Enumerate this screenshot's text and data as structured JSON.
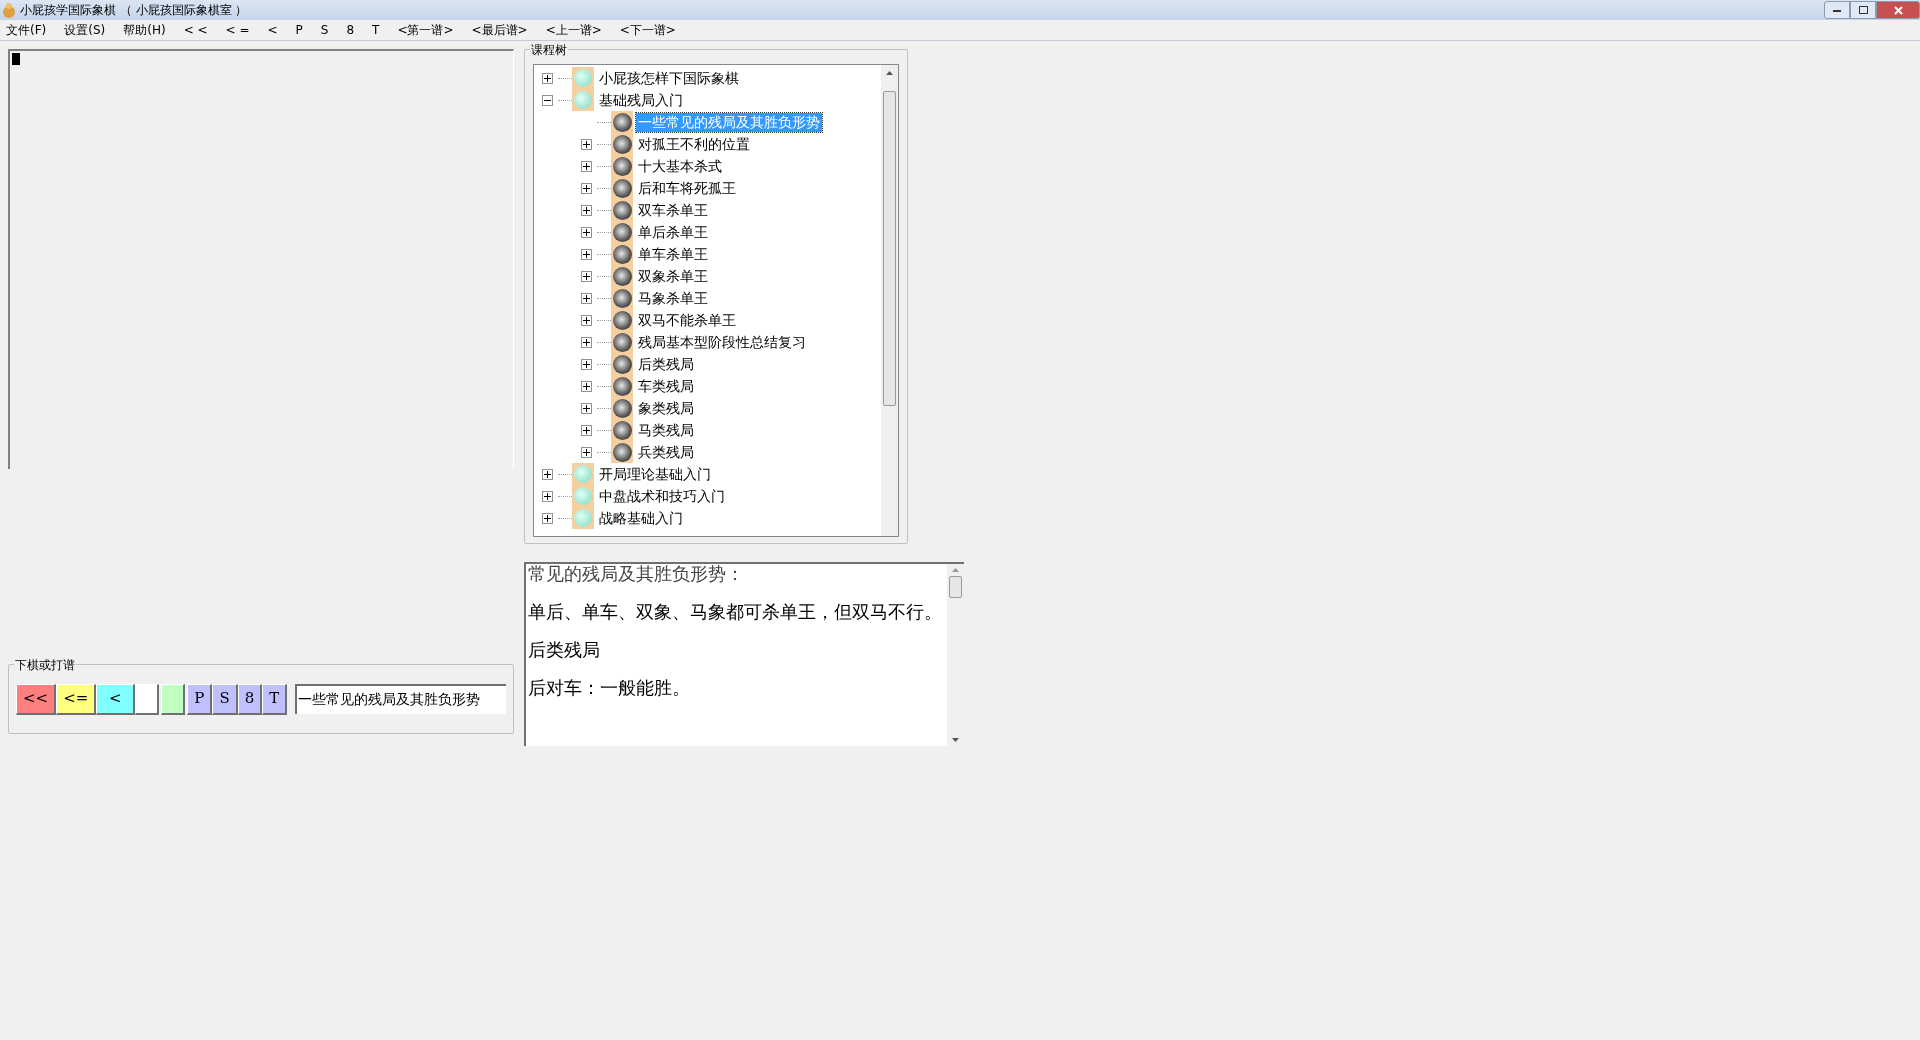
{
  "window": {
    "title": "小屁孩学国际象棋 （ 小屁孩国际象棋室 ）"
  },
  "menu": [
    "文件(F)",
    "设置(S)",
    "帮助(H)",
    "< <",
    "< =",
    "<",
    "P",
    "S",
    "8",
    "T",
    "<第一谱>",
    "<最后谱>",
    "<上一谱>",
    "<下一谱>"
  ],
  "course_tree": {
    "title": "课程树",
    "items": [
      {
        "label": "小屁孩怎样下国际象棋",
        "expanded": false,
        "selected": false
      },
      {
        "label": "基础残局入门",
        "expanded": true,
        "selected": false,
        "children": [
          {
            "label": "一些常见的残局及其胜负形势",
            "selected": true
          },
          {
            "label": "对孤王不利的位置",
            "expanded": false,
            "selected": false
          },
          {
            "label": "十大基本杀式",
            "expanded": false,
            "selected": false
          },
          {
            "label": "后和车将死孤王",
            "expanded": false,
            "selected": false
          },
          {
            "label": "双车杀单王",
            "expanded": false,
            "selected": false
          },
          {
            "label": "单后杀单王",
            "expanded": false,
            "selected": false
          },
          {
            "label": "单车杀单王",
            "expanded": false,
            "selected": false
          },
          {
            "label": "双象杀单王",
            "expanded": false,
            "selected": false
          },
          {
            "label": "马象杀单王",
            "expanded": false,
            "selected": false
          },
          {
            "label": "双马不能杀单王",
            "expanded": false,
            "selected": false
          },
          {
            "label": "残局基本型阶段性总结复习",
            "expanded": false,
            "selected": false
          },
          {
            "label": "后类残局",
            "expanded": false,
            "selected": false
          },
          {
            "label": "车类残局",
            "expanded": false,
            "selected": false
          },
          {
            "label": "象类残局",
            "expanded": false,
            "selected": false
          },
          {
            "label": "马类残局",
            "expanded": false,
            "selected": false
          },
          {
            "label": "兵类残局",
            "expanded": false,
            "selected": false
          }
        ]
      },
      {
        "label": "开局理论基础入门",
        "expanded": false,
        "selected": false
      },
      {
        "label": "中盘战术和技巧入门",
        "expanded": false,
        "selected": false
      },
      {
        "label": "战略基础入门",
        "expanded": false,
        "selected": false
      }
    ]
  },
  "lesson_text": [
    "常见的残局及其胜负形势：",
    "单后、单车、双象、马象都可杀单王，但双马不行。",
    "后类残局",
    "后对车：一般能胜。"
  ],
  "play_panel": {
    "title": "下棋或打谱",
    "buttons": [
      {
        "label": "<<",
        "color": "#ff7f7f"
      },
      {
        "label": "<=",
        "color": "#ffff80"
      },
      {
        "label": "<",
        "color": "#80ffff"
      },
      {
        "color": "#ffffff"
      },
      {
        "color": "#c0ffc0"
      },
      {
        "label": "P",
        "color": "#c0c0ff"
      },
      {
        "label": "S",
        "color": "#c0c0ff"
      },
      {
        "label": "8",
        "color": "#c0c0ff"
      },
      {
        "label": "T",
        "color": "#c0c0ff"
      }
    ],
    "field_value": "一些常见的残局及其胜负形势"
  }
}
